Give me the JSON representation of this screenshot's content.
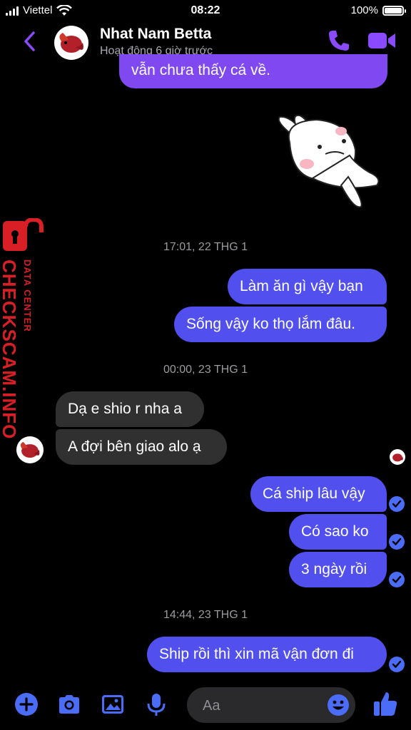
{
  "status_bar": {
    "carrier": "Viettel",
    "time": "08:22",
    "battery": "100%"
  },
  "header": {
    "name": "Nhat Nam Betta",
    "subtitle": "Hoạt động 6 giờ trước"
  },
  "messages": {
    "m0": "vẫn chưa thấy cá về.",
    "ts1": "17:01, 22 THG 1",
    "m1": "Làm ăn gì vậy bạn",
    "m2": "Sống vậy ko thọ lắm đâu.",
    "ts2": "00:00, 23 THG 1",
    "m3": "Dạ e shio r nha a",
    "m4": "A đợi bên giao alo ạ",
    "m5": "Cá ship lâu vậy",
    "m6": "Có sao ko",
    "m7": "3 ngày rồi",
    "ts3": "14:44, 23 THG 1",
    "m8": "Ship rồi thì xin mã vận đơn đi"
  },
  "watermark": {
    "big": "CHECKSCAM.INFO",
    "small": "DATA CENTER"
  },
  "composer": {
    "placeholder": "Aa"
  },
  "colors": {
    "accent": "#8a4bff",
    "outgoing": "#5150ee",
    "incoming": "#303030",
    "watermark": "#d81f26"
  },
  "icons": [
    "back-chevron-icon",
    "phone-icon",
    "video-icon",
    "plus-icon",
    "camera-icon",
    "gallery-icon",
    "mic-icon",
    "emoji-icon",
    "thumbs-up-icon",
    "check-icon",
    "lock-icon"
  ]
}
